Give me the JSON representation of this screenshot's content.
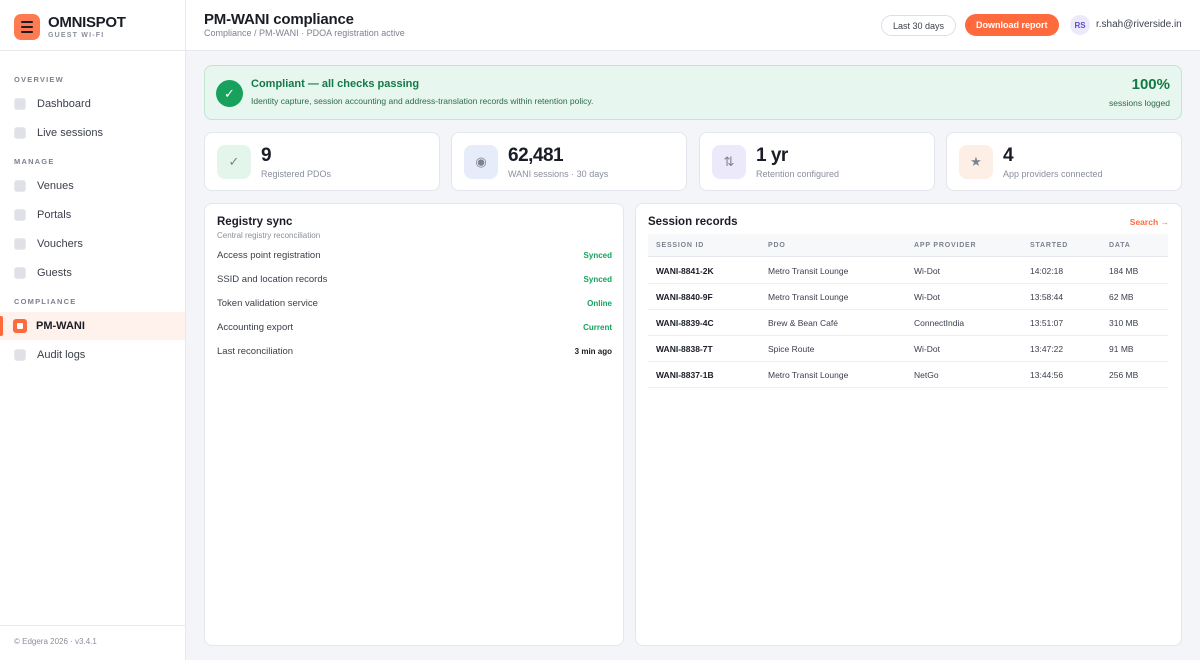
{
  "brand": {
    "name": "OMNISPOT",
    "subtitle": "GUEST WI-FI"
  },
  "sidebar": {
    "sections": [
      {
        "title": "OVERVIEW"
      },
      {
        "title": "MANAGE"
      },
      {
        "title": "COMPLIANCE"
      }
    ],
    "items": [
      {
        "label": "Dashboard"
      },
      {
        "label": "Live sessions"
      },
      {
        "label": "Venues"
      },
      {
        "label": "Portals"
      },
      {
        "label": "Vouchers"
      },
      {
        "label": "Guests"
      },
      {
        "label": "PM-WANI",
        "active": true
      },
      {
        "label": "Audit logs"
      }
    ],
    "footer": "© Edgera 2026 · v3.4.1"
  },
  "header": {
    "title": "PM-WANI compliance",
    "breadcrumb": "Compliance / PM-WANI · PDOA registration active",
    "range_label": "Last 30 days",
    "download_label": "Download report",
    "avatar_initials": "RS",
    "user_email": "r.shah@riverside.in"
  },
  "banner": {
    "title": "Compliant — all checks passing",
    "description": "Identity capture, session accounting and address-translation records within retention policy.",
    "percent": "100%",
    "percent_label": "sessions logged"
  },
  "stats": [
    {
      "value": "9",
      "label": "Registered PDOs",
      "icon": "check-icon",
      "icon_bg": "#e4f5ec"
    },
    {
      "value": "62,481",
      "label": "WANI sessions · 30 days",
      "icon": "radio-icon",
      "icon_bg": "#e6ecf9"
    },
    {
      "value": "1 yr",
      "label": "Retention configured",
      "icon": "transfer-icon",
      "icon_bg": "#ece9fb"
    },
    {
      "value": "4",
      "label": "App providers connected",
      "icon": "star-icon",
      "icon_bg": "#fdeee6"
    }
  ],
  "registry": {
    "title": "Registry sync",
    "subtitle": "Central registry reconciliation",
    "rows": [
      {
        "label": "Access point registration",
        "status": "Synced"
      },
      {
        "label": "SSID and location records",
        "status": "Synced"
      },
      {
        "label": "Token validation service",
        "status": "Online"
      },
      {
        "label": "Accounting export",
        "status": "Current"
      },
      {
        "label": "Last reconciliation",
        "status": "3 min ago"
      }
    ]
  },
  "sessions": {
    "title": "Session records",
    "search_label": "Search →",
    "columns": [
      "SESSION ID",
      "PDO",
      "APP PROVIDER",
      "STARTED",
      "DATA"
    ],
    "rows": [
      [
        "WANI-8841-2K",
        "Metro Transit Lounge",
        "Wi-Dot",
        "14:02:18",
        "184 MB"
      ],
      [
        "WANI-8840-9F",
        "Metro Transit Lounge",
        "Wi-Dot",
        "13:58:44",
        "62 MB"
      ],
      [
        "WANI-8839-4C",
        "Brew & Bean Café",
        "ConnectIndia",
        "13:51:07",
        "310 MB"
      ],
      [
        "WANI-8838-7T",
        "Spice Route",
        "Wi-Dot",
        "13:47:22",
        "91 MB"
      ],
      [
        "WANI-8837-1B",
        "Metro Transit Lounge",
        "NetGo",
        "13:44:56",
        "256 MB"
      ]
    ]
  },
  "colors": {
    "accent": "#ff6a3d",
    "success": "#17a15c"
  }
}
